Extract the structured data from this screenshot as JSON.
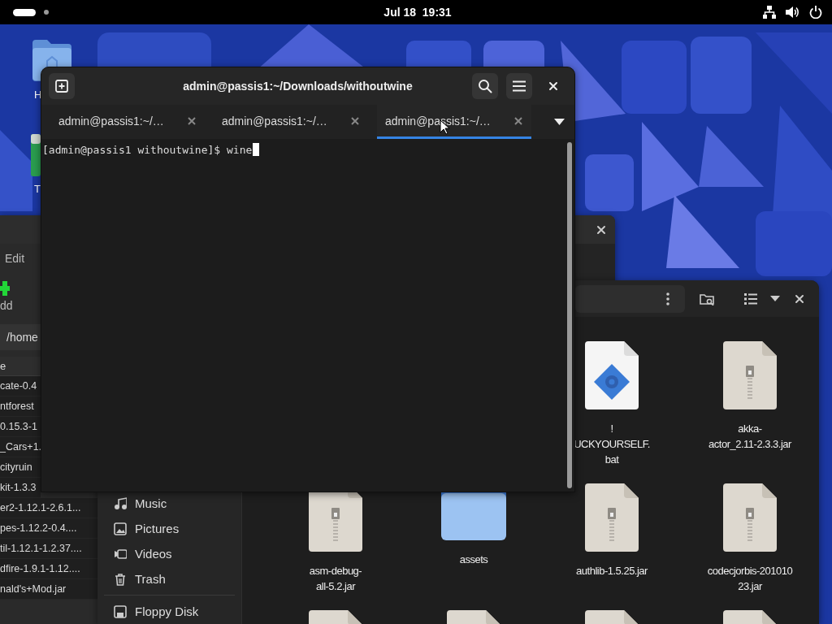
{
  "top_bar": {
    "date": "Jul 18",
    "time": "19:31"
  },
  "desktop_icons": [
    {
      "kind": "home-folder",
      "label": "H"
    },
    {
      "kind": "app",
      "label": "T"
    }
  ],
  "back_window": {
    "menu": [
      "Edit"
    ],
    "toolbar_button": "dd",
    "path": "/home",
    "column_header": "e",
    "rows": [
      "cate-0.4",
      "ntforest",
      "0.15.3-1",
      "_Cars+1.",
      "cityruin",
      "kit-1.3.3",
      "er2-1.12.1-2.6.1...",
      "pes-1.12.2-0.4....",
      "til-1.12.1-1.2.37....",
      "dfire-1.9.1-1.12....",
      "nald's+Mod.jar"
    ]
  },
  "file_manager": {
    "sidebar": [
      {
        "kind": "music",
        "label": "Music"
      },
      {
        "kind": "pictures",
        "label": "Pictures"
      },
      {
        "kind": "videos",
        "label": "Videos"
      },
      {
        "kind": "trash",
        "label": "Trash"
      },
      {
        "kind": "drive",
        "label": "Floppy Disk"
      }
    ],
    "file_rows": [
      [
        {
          "kind": "script",
          "label": "!\nUCKYOURSELF.\nbat"
        },
        {
          "kind": "zip",
          "label": "akka-\nactor_2.11-2.3.3.jar"
        }
      ],
      [
        {
          "kind": "zip",
          "label": "asm-debug-\nall-5.2.jar"
        },
        {
          "kind": "folder",
          "label": "assets"
        },
        {
          "kind": "zip",
          "label": "authlib-1.5.25.jar"
        },
        {
          "kind": "zip",
          "label": "codecjorbis-201010\n23.jar"
        }
      ],
      [
        {
          "kind": "zip"
        },
        {
          "kind": "zip"
        },
        {
          "kind": "zip"
        },
        {
          "kind": "zip"
        }
      ]
    ]
  },
  "terminal": {
    "title": "admin@passis1:~/Downloads/withoutwine",
    "tabs": [
      {
        "label": "admin@passis1:~/…",
        "selected": false
      },
      {
        "label": "admin@passis1:~/…",
        "selected": false
      },
      {
        "label": "admin@passis1:~/…",
        "selected": true
      }
    ],
    "command_line": "[admin@passis1 withoutwine]$ wine"
  }
}
